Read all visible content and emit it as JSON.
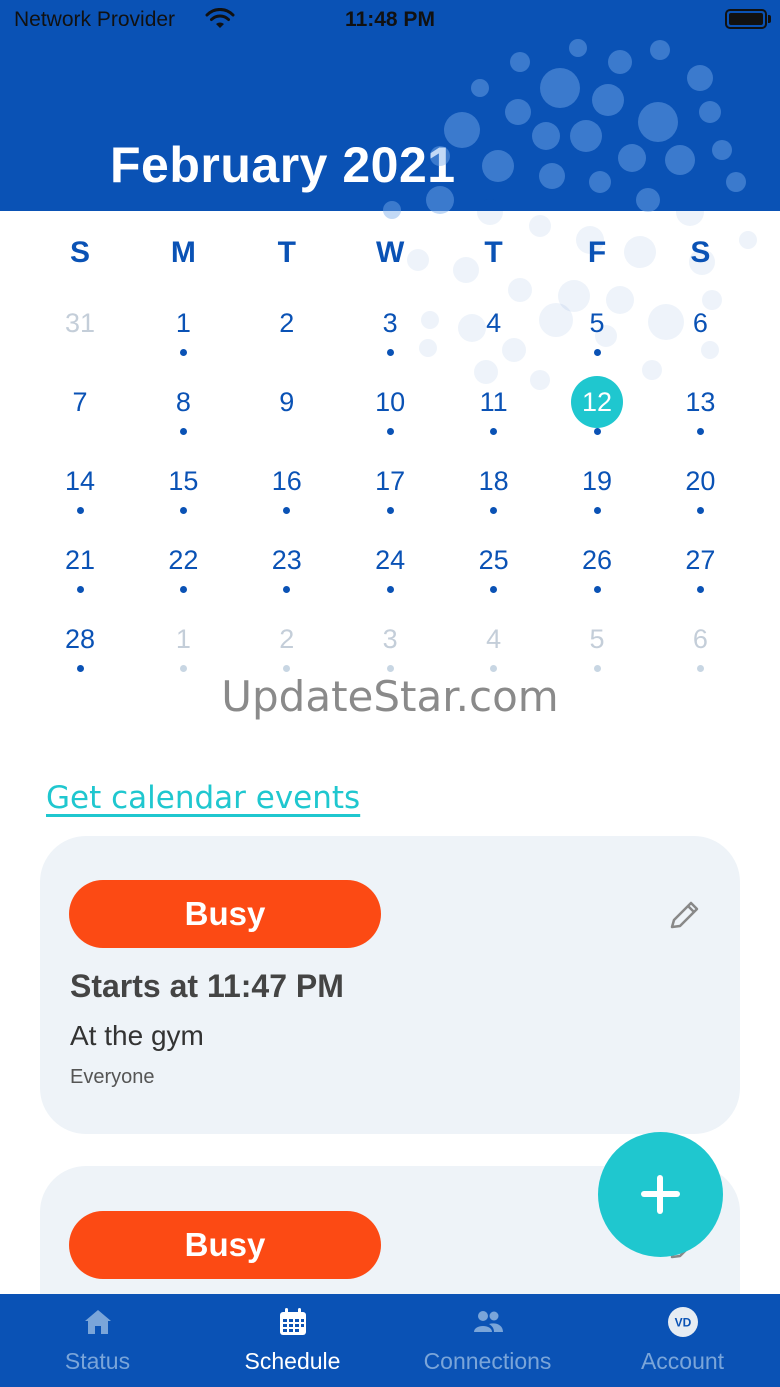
{
  "status_bar": {
    "provider": "Network Provider",
    "time": "11:48 PM"
  },
  "header": {
    "title": "February 2021"
  },
  "weekdays": [
    "S",
    "M",
    "T",
    "W",
    "T",
    "F",
    "S"
  ],
  "days": [
    {
      "n": "31",
      "muted": true,
      "dot": false
    },
    {
      "n": "1",
      "muted": false,
      "dot": true
    },
    {
      "n": "2",
      "muted": false,
      "dot": false
    },
    {
      "n": "3",
      "muted": false,
      "dot": true
    },
    {
      "n": "4",
      "muted": false,
      "dot": false
    },
    {
      "n": "5",
      "muted": false,
      "dot": true
    },
    {
      "n": "6",
      "muted": false,
      "dot": false
    },
    {
      "n": "7",
      "muted": false,
      "dot": false
    },
    {
      "n": "8",
      "muted": false,
      "dot": true
    },
    {
      "n": "9",
      "muted": false,
      "dot": false
    },
    {
      "n": "10",
      "muted": false,
      "dot": true
    },
    {
      "n": "11",
      "muted": false,
      "dot": true
    },
    {
      "n": "12",
      "muted": false,
      "dot": true,
      "selected": true
    },
    {
      "n": "13",
      "muted": false,
      "dot": true
    },
    {
      "n": "14",
      "muted": false,
      "dot": true
    },
    {
      "n": "15",
      "muted": false,
      "dot": true
    },
    {
      "n": "16",
      "muted": false,
      "dot": true
    },
    {
      "n": "17",
      "muted": false,
      "dot": true
    },
    {
      "n": "18",
      "muted": false,
      "dot": true
    },
    {
      "n": "19",
      "muted": false,
      "dot": true
    },
    {
      "n": "20",
      "muted": false,
      "dot": true
    },
    {
      "n": "21",
      "muted": false,
      "dot": true
    },
    {
      "n": "22",
      "muted": false,
      "dot": true
    },
    {
      "n": "23",
      "muted": false,
      "dot": true
    },
    {
      "n": "24",
      "muted": false,
      "dot": true
    },
    {
      "n": "25",
      "muted": false,
      "dot": true
    },
    {
      "n": "26",
      "muted": false,
      "dot": true
    },
    {
      "n": "27",
      "muted": false,
      "dot": true
    },
    {
      "n": "28",
      "muted": false,
      "dot": true
    },
    {
      "n": "1",
      "muted": true,
      "dot": true
    },
    {
      "n": "2",
      "muted": true,
      "dot": true
    },
    {
      "n": "3",
      "muted": true,
      "dot": true
    },
    {
      "n": "4",
      "muted": true,
      "dot": true
    },
    {
      "n": "5",
      "muted": true,
      "dot": true
    },
    {
      "n": "6",
      "muted": true,
      "dot": true
    }
  ],
  "watermark": "UpdateStar.com",
  "calendar_link": "Get calendar events",
  "events": [
    {
      "status": "Busy",
      "title": "Starts at 11:47 PM",
      "subtitle": "At the gym",
      "audience": "Everyone"
    },
    {
      "status": "Busy"
    }
  ],
  "tabs": [
    {
      "label": "Status",
      "icon": "home-icon",
      "active": false
    },
    {
      "label": "Schedule",
      "icon": "calendar-icon",
      "active": true
    },
    {
      "label": "Connections",
      "icon": "people-icon",
      "active": false
    },
    {
      "label": "Account",
      "icon": "avatar-icon",
      "avatar_initials": "VD",
      "active": false
    }
  ],
  "colors": {
    "brand": "#0a52b5",
    "accent": "#1fc7cf",
    "busy": "#fc4a14",
    "card": "#eef3f8"
  }
}
